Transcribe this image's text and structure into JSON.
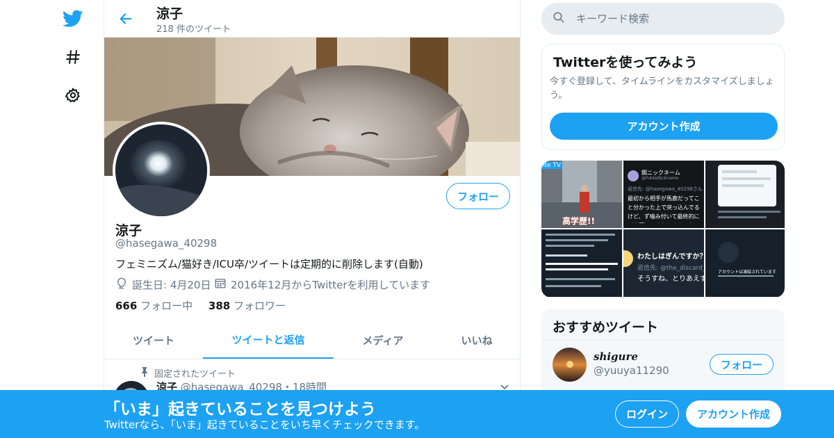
{
  "colors": {
    "accent": "#1da1f2",
    "text": "#14171a",
    "secondary": "#657786",
    "border": "#e6ecf0"
  },
  "nav": {
    "icons": [
      "twitter-logo-icon",
      "hashtag-icon",
      "gear-icon"
    ]
  },
  "header": {
    "title": "涼子",
    "tweet_count": "218 件のツイート"
  },
  "profile": {
    "follow_label": "フォロー",
    "name": "涼子",
    "handle": "@hasegawa_40298",
    "bio": "フェミニズム/猫好き/ICU卒/ツイートは定期的に削除します(自動)",
    "birthday": "誕生日: 4月20日",
    "joined": "2016年12月からTwitterを利用しています",
    "following_count": "666",
    "following_label": "フォロー中",
    "followers_count": "388",
    "followers_label": "フォロワー"
  },
  "tabs": [
    {
      "label": "ツイート",
      "active": false
    },
    {
      "label": "ツイートと返信",
      "active": true
    },
    {
      "label": "メディア",
      "active": false
    },
    {
      "label": "いいね",
      "active": false
    }
  ],
  "pinned_tweet": {
    "pinned_label": "固定されたツイート",
    "author": "涼子",
    "handle_time": "@hasegawa_40298・18時間"
  },
  "search": {
    "placeholder": "キーワード検索"
  },
  "signup_card": {
    "title": "Twitterを使ってみよう",
    "text": "今すぐ登録して、タイムラインをカスタマイズしましょう。",
    "button": "アカウント作成"
  },
  "media_grid": [
    {
      "caption_top": "ite TV",
      "caption_bottom": "高学歴!!"
    },
    {
      "name": "餌ニックネーム",
      "handle": "@FukkeNickname",
      "reply": "返信先: @hasegawa_40298さん",
      "text": "最初から相手が馬鹿だってこと分かった上で突っ込んでるけど、ず噛み付いて最終的に（言葉）...そうとする...うーん...棋作だな"
    },
    {
      "text": ""
    },
    {
      "text": ""
    },
    {
      "title": "わたしはぎんですか？",
      "reply": "返信先: @the_discard_",
      "text": "そうすね、とりあえず"
    },
    {
      "text": "アカウントは凍結されています"
    }
  ],
  "recommended": {
    "title": "おすすめツイート",
    "user_name": "shigure",
    "user_handle": "@yuuya11290",
    "follow_label": "フォロー"
  },
  "bottom_bar": {
    "title": "「いま」起きていることを見つけよう",
    "subtitle": "Twitterなら、「いま」起きていることをいち早くチェックできます。",
    "login": "ログイン",
    "signup": "アカウント作成"
  }
}
